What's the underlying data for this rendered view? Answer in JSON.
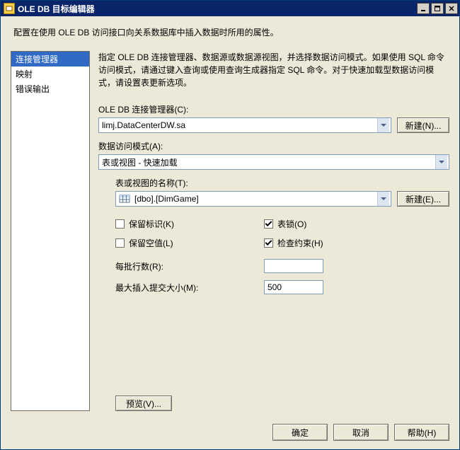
{
  "window": {
    "title": "OLE DB 目标编辑器"
  },
  "description": "配置在使用 OLE DB 访问接口向关系数据库中插入数据时所用的属性。",
  "sidebar": {
    "items": [
      {
        "label": "连接管理器",
        "selected": true
      },
      {
        "label": "映射",
        "selected": false
      },
      {
        "label": "错误输出",
        "selected": false
      }
    ]
  },
  "instruction": "指定 OLE DB 连接管理器、数据源或数据源视图，并选择数据访问模式。如果使用 SQL 命令访问模式，请通过键入查询或使用查询生成器指定 SQL 命令。对于快速加载型数据访问模式，请设置表更新选项。",
  "fields": {
    "conn_label": "OLE DB 连接管理器(C):",
    "conn_value": "limj.DataCenterDW.sa",
    "new_conn_label": "新建(N)...",
    "mode_label": "数据访问模式(A):",
    "mode_value": "表或视图 - 快速加载",
    "table_label": "表或视图的名称(T):",
    "table_value": "[dbo].[DimGame]",
    "new_table_label": "新建(E)...",
    "keep_identity_label": "保留标识(K)",
    "keep_identity_checked": false,
    "table_lock_label": "表锁(O)",
    "table_lock_checked": true,
    "keep_nulls_label": "保留空值(L)",
    "keep_nulls_checked": false,
    "check_constraints_label": "检查约束(H)",
    "check_constraints_checked": true,
    "rows_per_batch_label": "每批行数(R):",
    "rows_per_batch_value": "",
    "max_commit_label": "最大插入提交大小(M):",
    "max_commit_value": "500",
    "preview_label": "预览(V)..."
  },
  "footer": {
    "ok": "确定",
    "cancel": "取消",
    "help": "帮助(H)"
  }
}
